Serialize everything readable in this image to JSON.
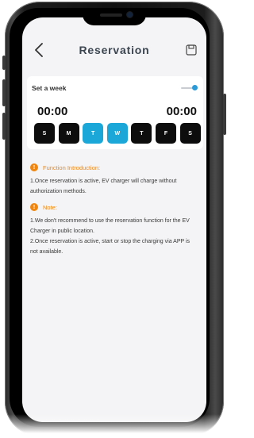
{
  "header": {
    "title": "Reservation",
    "back_icon": "chevron-left-icon",
    "save_icon": "save-disk-icon"
  },
  "schedule": {
    "week_label": "Set a week",
    "toggle_on": true,
    "start_time": "00:00",
    "end_time": "00:00",
    "days": [
      {
        "label": "S",
        "active": false
      },
      {
        "label": "M",
        "active": false
      },
      {
        "label": "T",
        "active": true
      },
      {
        "label": "W",
        "active": true
      },
      {
        "label": "T",
        "active": false
      },
      {
        "label": "F",
        "active": false
      },
      {
        "label": "S",
        "active": false
      }
    ]
  },
  "intro": {
    "title": "Function Introduction:",
    "text": "1.Once reservation is active, EV charger will charge without authorization methods."
  },
  "note": {
    "title": "Note:",
    "text": "1.We don't recommend to use the reservation function for the EV Charger in public location.\n2.Once reservation is active, start or stop the charging via APP is not available."
  },
  "colors": {
    "accent": "#1ca7d9",
    "warning": "#f0860d",
    "day_inactive": "#0d0d0d",
    "screen_bg": "#f4f4f6"
  }
}
